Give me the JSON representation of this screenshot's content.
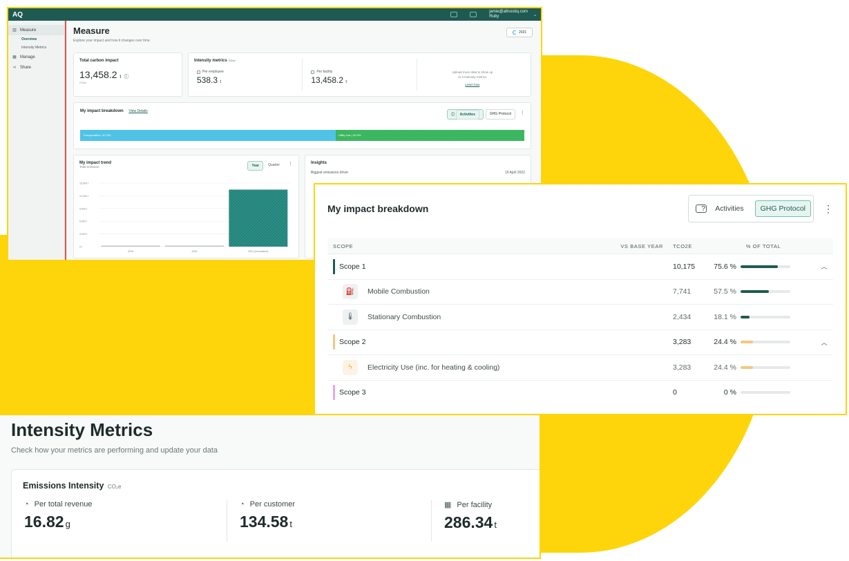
{
  "app": {
    "logo": "AQ",
    "user_email": "jamie@altruistiq.com",
    "user_name": "Ruby",
    "sidebar": {
      "measure": "Measure",
      "overview": "Overview",
      "intensity_metrics": "Intensity Metrics",
      "manage": "Manage",
      "share": "Share"
    },
    "page": {
      "title": "Measure",
      "subtitle": "Explore your impact and how it changes over time.",
      "year": "2021"
    },
    "total": {
      "title": "Total carbon impact",
      "value": "13,458.2",
      "unit": "t",
      "sub": "CO₂e"
    },
    "intensity": {
      "title": "Intensity metrics",
      "unit": "CO₂e",
      "per_employee_label": "Per employee",
      "per_employee_value": "538.3",
      "per_facility_label": "Per facility",
      "per_facility_value": "13,458.2",
      "t": "t",
      "upload_line1": "Upload more data to show up",
      "upload_line2": "to 3 intensity metrics",
      "learn_more": "Learn how"
    },
    "breakdown": {
      "title": "My impact breakdown",
      "view_details": "View Details",
      "activities": "Activities",
      "ghg": "GHG Protocol",
      "seg1_label": "Transportation | 57.5%",
      "seg1_pct": 57.5,
      "seg2_label": "Utility Use | 42.5%",
      "seg2_pct": 42.5
    },
    "trend": {
      "title": "My impact trend",
      "sub": "Total emission",
      "year": "Year",
      "quarter": "Quarter",
      "ylim": [
        0,
        15000
      ],
      "yticks": [
        "15,000 t",
        "12,000 t",
        "9,000 t",
        "6,000 t",
        "3,000 t",
        "0 t"
      ],
      "categories": [
        "2019",
        "2020",
        "2021 (Annualized)"
      ],
      "values": [
        200,
        180,
        13458.2
      ]
    },
    "insights": {
      "title": "Insights",
      "driver": "Biggest emissions driver",
      "date": "19 April 2022"
    }
  },
  "breakdown_table": {
    "title": "My impact breakdown",
    "activities": "Activities",
    "ghg": "GHG Protocol",
    "headers": {
      "scope": "SCOPE",
      "vs": "VS BASE YEAR",
      "tco2e": "TCO2E",
      "pct": "% OF TOTAL"
    },
    "rows": [
      {
        "name": "Scope 1",
        "tco2e": "10,175",
        "pct": "75.6 %",
        "fill": 75.6,
        "color": "#1f5a52"
      },
      {
        "name": "Mobile Combustion",
        "tco2e": "7,741",
        "pct": "57.5 %",
        "fill": 57.5,
        "color": "#1f5a52"
      },
      {
        "name": "Stationary Combustion",
        "tco2e": "2,434",
        "pct": "18.1 %",
        "fill": 18.1,
        "color": "#1f5a52"
      },
      {
        "name": "Scope 2",
        "tco2e": "3,283",
        "pct": "24.4 %",
        "fill": 24.4,
        "color": "#f5c77e"
      },
      {
        "name": "Electricity Use (inc. for heating & cooling)",
        "tco2e": "3,283",
        "pct": "24.4 %",
        "fill": 24.4,
        "color": "#f5c77e"
      },
      {
        "name": "Scope 3",
        "tco2e": "0",
        "pct": "0 %",
        "fill": 0,
        "color": "#e8a8e0"
      }
    ]
  },
  "intensity_page": {
    "title": "Intensity Metrics",
    "subtitle": "Check how your metrics are performing and update your data",
    "card_title": "Emissions Intensity",
    "card_unit": "CO₂e",
    "revenue_label": "Per total revenue",
    "revenue_value": "16.82",
    "revenue_unit": "g",
    "customer_label": "Per customer",
    "customer_value": "134.58",
    "customer_unit": "t",
    "facility_label": "Per facility",
    "facility_value": "286.34",
    "facility_unit": "t"
  }
}
